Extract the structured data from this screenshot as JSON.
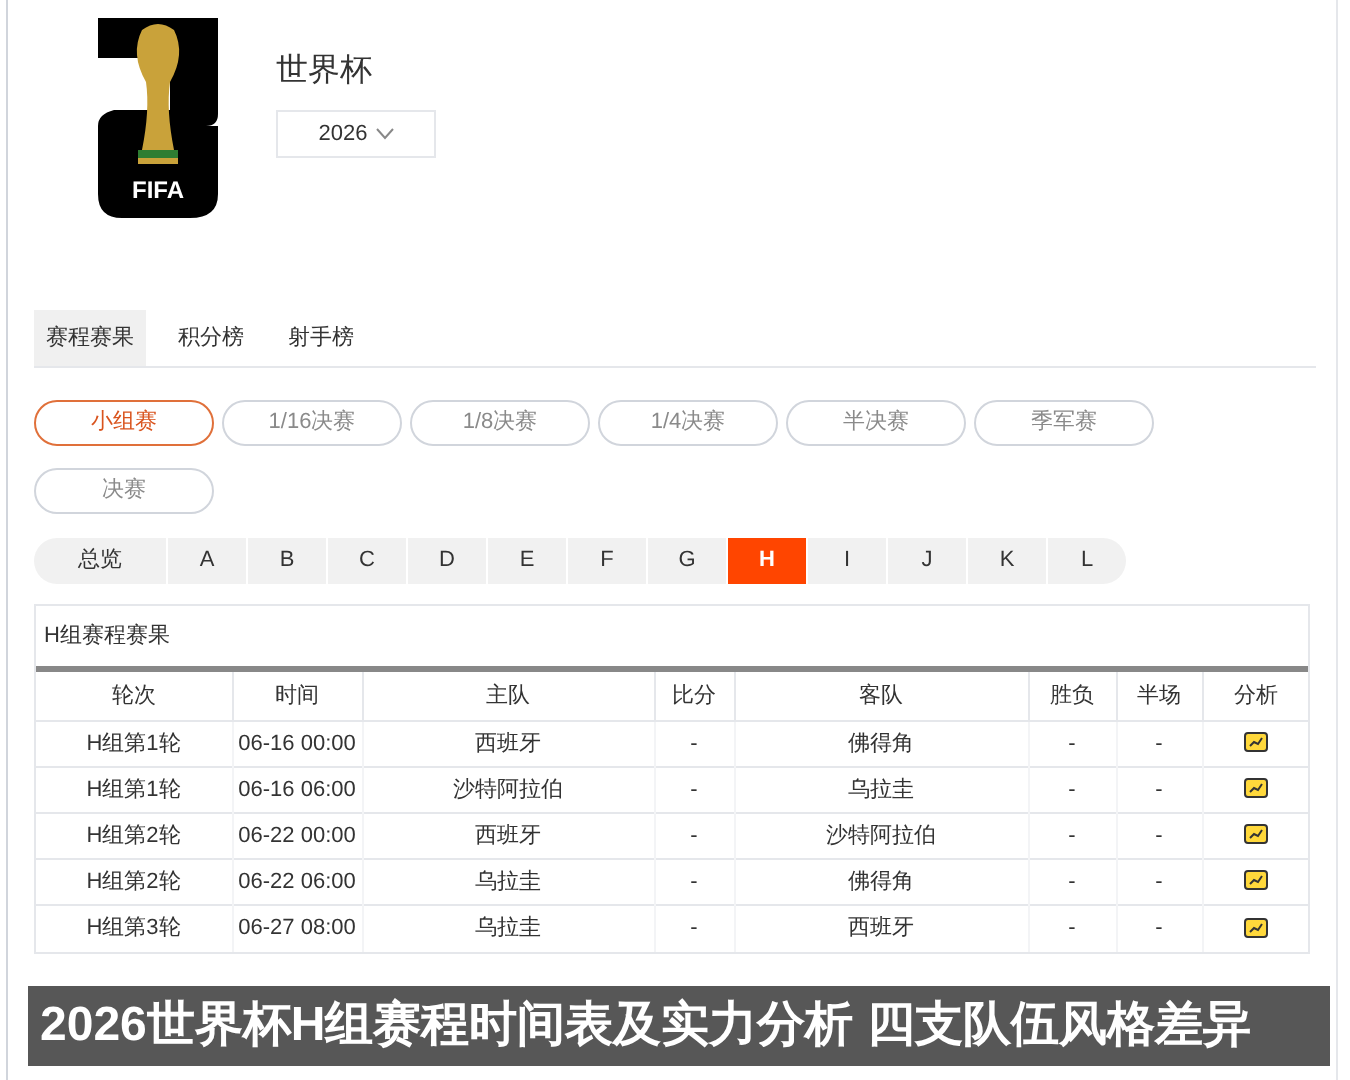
{
  "logo": {
    "label": "FIFA"
  },
  "title": "世界杯",
  "season": {
    "value": "2026"
  },
  "tabs": [
    {
      "label": "赛程赛果",
      "selected": true
    },
    {
      "label": "积分榜",
      "selected": false
    },
    {
      "label": "射手榜",
      "selected": false
    }
  ],
  "stages": [
    {
      "label": "小组赛",
      "selected": true
    },
    {
      "label": "1/16决赛",
      "selected": false
    },
    {
      "label": "1/8决赛",
      "selected": false
    },
    {
      "label": "1/4决赛",
      "selected": false
    },
    {
      "label": "半决赛",
      "selected": false
    },
    {
      "label": "季军赛",
      "selected": false
    },
    {
      "label": "决赛",
      "selected": false
    }
  ],
  "groups": [
    {
      "label": "总览",
      "selected": false
    },
    {
      "label": "A",
      "selected": false
    },
    {
      "label": "B",
      "selected": false
    },
    {
      "label": "C",
      "selected": false
    },
    {
      "label": "D",
      "selected": false
    },
    {
      "label": "E",
      "selected": false
    },
    {
      "label": "F",
      "selected": false
    },
    {
      "label": "G",
      "selected": false
    },
    {
      "label": "H",
      "selected": true
    },
    {
      "label": "I",
      "selected": false
    },
    {
      "label": "J",
      "selected": false
    },
    {
      "label": "K",
      "selected": false
    },
    {
      "label": "L",
      "selected": false
    }
  ],
  "table": {
    "title": "H组赛程赛果",
    "columns": [
      "轮次",
      "时间",
      "主队",
      "比分",
      "客队",
      "胜负",
      "半场",
      "分析"
    ],
    "rows": [
      {
        "round": "H组第1轮",
        "time": "06-16 00:00",
        "home": "西班牙",
        "score": "-",
        "away": "佛得角",
        "result": "-",
        "half": "-"
      },
      {
        "round": "H组第1轮",
        "time": "06-16 06:00",
        "home": "沙特阿拉伯",
        "score": "-",
        "away": "乌拉圭",
        "result": "-",
        "half": "-"
      },
      {
        "round": "H组第2轮",
        "time": "06-22 00:00",
        "home": "西班牙",
        "score": "-",
        "away": "沙特阿拉伯",
        "result": "-",
        "half": "-"
      },
      {
        "round": "H组第2轮",
        "time": "06-22 06:00",
        "home": "乌拉圭",
        "score": "-",
        "away": "佛得角",
        "result": "-",
        "half": "-"
      },
      {
        "round": "H组第3轮",
        "time": "06-27 08:00",
        "home": "乌拉圭",
        "score": "-",
        "away": "西班牙",
        "result": "-",
        "half": "-"
      }
    ]
  },
  "caption": "2026世界杯H组赛程时间表及实力分析 四支队伍风格差异"
}
